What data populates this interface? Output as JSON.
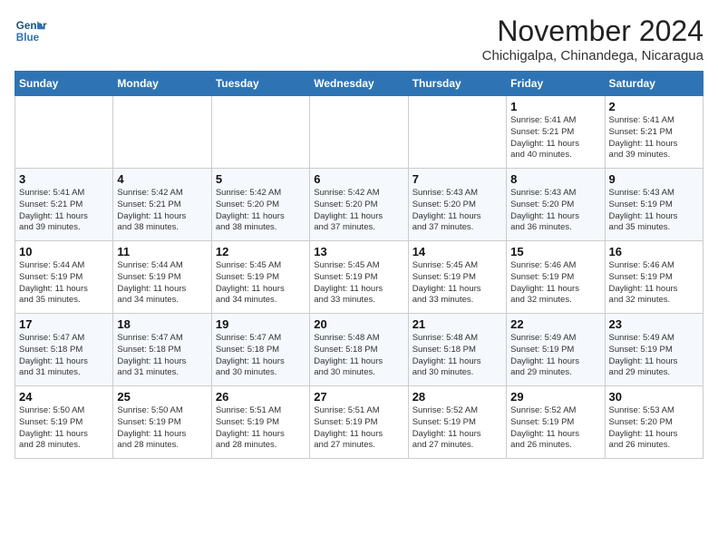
{
  "logo": {
    "line1": "General",
    "line2": "Blue"
  },
  "title": "November 2024",
  "location": "Chichigalpa, Chinandega, Nicaragua",
  "weekdays": [
    "Sunday",
    "Monday",
    "Tuesday",
    "Wednesday",
    "Thursday",
    "Friday",
    "Saturday"
  ],
  "weeks": [
    [
      {
        "day": "",
        "info": ""
      },
      {
        "day": "",
        "info": ""
      },
      {
        "day": "",
        "info": ""
      },
      {
        "day": "",
        "info": ""
      },
      {
        "day": "",
        "info": ""
      },
      {
        "day": "1",
        "info": "Sunrise: 5:41 AM\nSunset: 5:21 PM\nDaylight: 11 hours\nand 40 minutes."
      },
      {
        "day": "2",
        "info": "Sunrise: 5:41 AM\nSunset: 5:21 PM\nDaylight: 11 hours\nand 39 minutes."
      }
    ],
    [
      {
        "day": "3",
        "info": "Sunrise: 5:41 AM\nSunset: 5:21 PM\nDaylight: 11 hours\nand 39 minutes."
      },
      {
        "day": "4",
        "info": "Sunrise: 5:42 AM\nSunset: 5:21 PM\nDaylight: 11 hours\nand 38 minutes."
      },
      {
        "day": "5",
        "info": "Sunrise: 5:42 AM\nSunset: 5:20 PM\nDaylight: 11 hours\nand 38 minutes."
      },
      {
        "day": "6",
        "info": "Sunrise: 5:42 AM\nSunset: 5:20 PM\nDaylight: 11 hours\nand 37 minutes."
      },
      {
        "day": "7",
        "info": "Sunrise: 5:43 AM\nSunset: 5:20 PM\nDaylight: 11 hours\nand 37 minutes."
      },
      {
        "day": "8",
        "info": "Sunrise: 5:43 AM\nSunset: 5:20 PM\nDaylight: 11 hours\nand 36 minutes."
      },
      {
        "day": "9",
        "info": "Sunrise: 5:43 AM\nSunset: 5:19 PM\nDaylight: 11 hours\nand 35 minutes."
      }
    ],
    [
      {
        "day": "10",
        "info": "Sunrise: 5:44 AM\nSunset: 5:19 PM\nDaylight: 11 hours\nand 35 minutes."
      },
      {
        "day": "11",
        "info": "Sunrise: 5:44 AM\nSunset: 5:19 PM\nDaylight: 11 hours\nand 34 minutes."
      },
      {
        "day": "12",
        "info": "Sunrise: 5:45 AM\nSunset: 5:19 PM\nDaylight: 11 hours\nand 34 minutes."
      },
      {
        "day": "13",
        "info": "Sunrise: 5:45 AM\nSunset: 5:19 PM\nDaylight: 11 hours\nand 33 minutes."
      },
      {
        "day": "14",
        "info": "Sunrise: 5:45 AM\nSunset: 5:19 PM\nDaylight: 11 hours\nand 33 minutes."
      },
      {
        "day": "15",
        "info": "Sunrise: 5:46 AM\nSunset: 5:19 PM\nDaylight: 11 hours\nand 32 minutes."
      },
      {
        "day": "16",
        "info": "Sunrise: 5:46 AM\nSunset: 5:19 PM\nDaylight: 11 hours\nand 32 minutes."
      }
    ],
    [
      {
        "day": "17",
        "info": "Sunrise: 5:47 AM\nSunset: 5:18 PM\nDaylight: 11 hours\nand 31 minutes."
      },
      {
        "day": "18",
        "info": "Sunrise: 5:47 AM\nSunset: 5:18 PM\nDaylight: 11 hours\nand 31 minutes."
      },
      {
        "day": "19",
        "info": "Sunrise: 5:47 AM\nSunset: 5:18 PM\nDaylight: 11 hours\nand 30 minutes."
      },
      {
        "day": "20",
        "info": "Sunrise: 5:48 AM\nSunset: 5:18 PM\nDaylight: 11 hours\nand 30 minutes."
      },
      {
        "day": "21",
        "info": "Sunrise: 5:48 AM\nSunset: 5:18 PM\nDaylight: 11 hours\nand 30 minutes."
      },
      {
        "day": "22",
        "info": "Sunrise: 5:49 AM\nSunset: 5:19 PM\nDaylight: 11 hours\nand 29 minutes."
      },
      {
        "day": "23",
        "info": "Sunrise: 5:49 AM\nSunset: 5:19 PM\nDaylight: 11 hours\nand 29 minutes."
      }
    ],
    [
      {
        "day": "24",
        "info": "Sunrise: 5:50 AM\nSunset: 5:19 PM\nDaylight: 11 hours\nand 28 minutes."
      },
      {
        "day": "25",
        "info": "Sunrise: 5:50 AM\nSunset: 5:19 PM\nDaylight: 11 hours\nand 28 minutes."
      },
      {
        "day": "26",
        "info": "Sunrise: 5:51 AM\nSunset: 5:19 PM\nDaylight: 11 hours\nand 28 minutes."
      },
      {
        "day": "27",
        "info": "Sunrise: 5:51 AM\nSunset: 5:19 PM\nDaylight: 11 hours\nand 27 minutes."
      },
      {
        "day": "28",
        "info": "Sunrise: 5:52 AM\nSunset: 5:19 PM\nDaylight: 11 hours\nand 27 minutes."
      },
      {
        "day": "29",
        "info": "Sunrise: 5:52 AM\nSunset: 5:19 PM\nDaylight: 11 hours\nand 26 minutes."
      },
      {
        "day": "30",
        "info": "Sunrise: 5:53 AM\nSunset: 5:20 PM\nDaylight: 11 hours\nand 26 minutes."
      }
    ]
  ]
}
